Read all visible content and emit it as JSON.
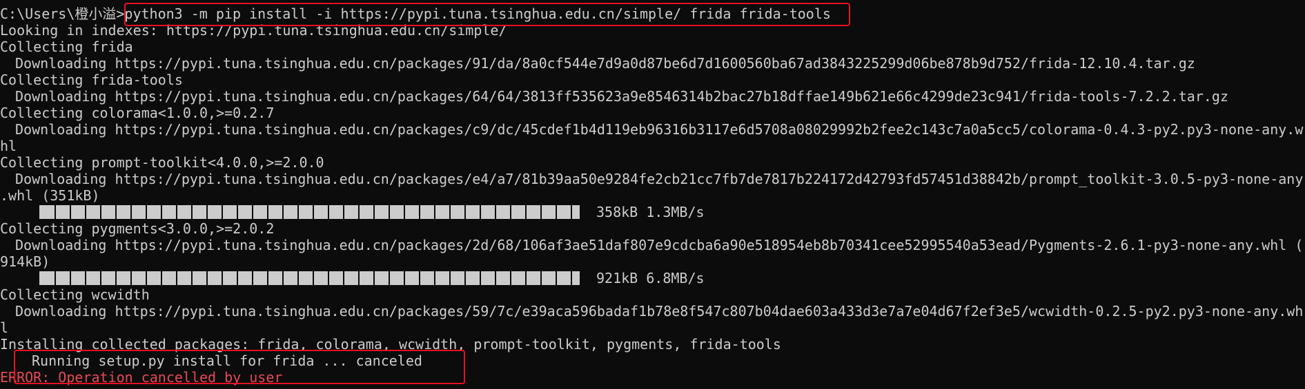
{
  "terminal": {
    "prompt": "C:\\Users\\橙小溢>",
    "command": "python3 -m pip install -i https://pypi.tuna.tsinghua.edu.cn/simple/ frida frida-tools",
    "lines": {
      "looking": "Looking in indexes: https://pypi.tuna.tsinghua.edu.cn/simple/",
      "collect_frida": "Collecting frida",
      "dl_frida": "Downloading https://pypi.tuna.tsinghua.edu.cn/packages/91/da/8a0cf544e7d9a0d87be6d7d1600560ba67ad3843225299d06be878b9d752/frida-12.10.4.tar.gz",
      "collect_frida_tools": "Collecting frida-tools",
      "dl_frida_tools": "Downloading https://pypi.tuna.tsinghua.edu.cn/packages/64/64/3813ff535623a9e8546314b2bac27b18dffae149b621e66c4299de23c941/frida-tools-7.2.2.tar.gz",
      "collect_colorama": "Collecting colorama<1.0.0,>=0.2.7",
      "dl_colorama_a": "Downloading https://pypi.tuna.tsinghua.edu.cn/packages/c9/dc/45cdef1b4d119eb96316b3117e6d5708a08029992b2fee2c143c7a0a5cc5/colorama-0.4.3-py2.py3-none-any.w",
      "dl_colorama_b": "hl",
      "collect_prompt": "Collecting prompt-toolkit<4.0.0,>=2.0.0",
      "dl_prompt_a": "Downloading https://pypi.tuna.tsinghua.edu.cn/packages/e4/a7/81b39aa50e9284fe2cb21cc7fb7de7817b224172d42793fd57451d38842b/prompt_toolkit-3.0.5-py3-none-any",
      "dl_prompt_b": ".whl (351kB)",
      "progress_prompt": "358kB 1.3MB/s",
      "collect_pygments": "Collecting pygments<3.0.0,>=2.0.2",
      "dl_pygments_a": "Downloading https://pypi.tuna.tsinghua.edu.cn/packages/2d/68/106af3ae51daf807e9cdcba6a90e518954eb8b70341cee52995540a53ead/Pygments-2.6.1-py3-none-any.whl (",
      "dl_pygments_b": "914kB)",
      "progress_pygments": "921kB 6.8MB/s",
      "collect_wcwidth": "Collecting wcwidth",
      "dl_wcwidth_a": "Downloading https://pypi.tuna.tsinghua.edu.cn/packages/59/7c/e39aca596badaf1b78e8f547c807b04dae603a433d3e7a7e04d67f2ef3e5/wcwidth-0.2.5-py2.py3-none-any.wh",
      "dl_wcwidth_b": "l",
      "installing": "Installing collected packages: frida, colorama, wcwidth, prompt-toolkit, pygments, frida-tools",
      "running_setup": "Running setup.py install for frida ... canceled",
      "error": "ERROR: Operation cancelled by user"
    },
    "progress": {
      "prompt_toolkit_fraction": 1.0,
      "pygments_fraction": 1.0
    },
    "colors": {
      "background": "#0c0c0c",
      "text": "#cccccc",
      "error": "#e74856",
      "highlight_box": "#e81123"
    }
  }
}
